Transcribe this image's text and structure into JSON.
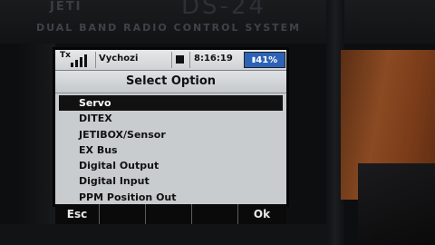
{
  "device": {
    "brand_left": "JETI",
    "model": "DS-24",
    "subtitle": "DUAL BAND RADIO CONTROL SYSTEM"
  },
  "status_bar": {
    "tx_label": "Tx",
    "model_name": "Vychozi",
    "time": "8:16:19",
    "battery_percent": "41%",
    "battery_color": "#2c63b8",
    "signal_icon": "signal-bars-icon",
    "stop_icon": "stop-square-icon"
  },
  "dialog": {
    "title": "Select Option",
    "options": [
      "Servo",
      "DITEX",
      "JETIBOX/Sensor",
      "EX Bus",
      "Digital Output",
      "Digital Input",
      "PPM Position Out"
    ],
    "selected_index": 0
  },
  "softkeys": {
    "left": "Esc",
    "right": "Ok"
  }
}
